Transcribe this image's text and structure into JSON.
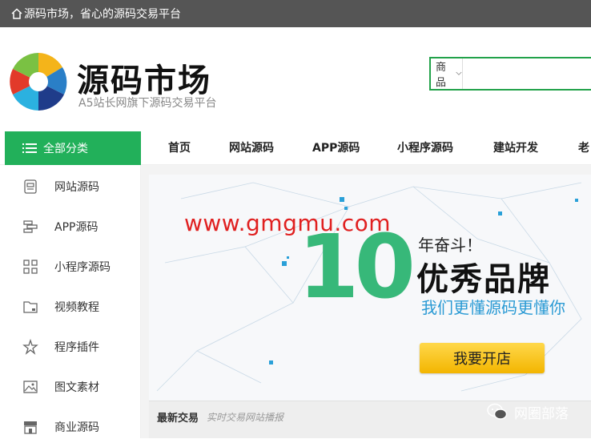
{
  "topbar": {
    "text": "源码市场，省心的源码交易平台"
  },
  "header": {
    "logo_title": "源码市场",
    "logo_subtitle": "A5站长网旗下源码交易平台"
  },
  "search": {
    "select_value": "商品",
    "input_value": "",
    "placeholder": ""
  },
  "nav": {
    "all_categories": "全部分类",
    "items": [
      "首页",
      "网站源码",
      "APP源码",
      "小程序源码",
      "建站开发",
      "老"
    ]
  },
  "sidebar": {
    "items": [
      {
        "label": "网站源码",
        "icon": "website-icon"
      },
      {
        "label": "APP源码",
        "icon": "app-icon"
      },
      {
        "label": "小程序源码",
        "icon": "grid-icon"
      },
      {
        "label": "视频教程",
        "icon": "folder-icon"
      },
      {
        "label": "程序插件",
        "icon": "plugin-icon"
      },
      {
        "label": "图文素材",
        "icon": "image-icon"
      },
      {
        "label": "商业源码",
        "icon": "store-icon"
      }
    ]
  },
  "banner": {
    "watermark_url": "www.gmgmu.com",
    "big_number": "10",
    "line1": "年奋斗！",
    "line2": "优秀品牌",
    "line3": "我们更懂源码更懂你",
    "cta": "我要开店",
    "colors": {
      "accent": "#22b05a",
      "cta": "#f5bf1a",
      "url": "#e02020"
    }
  },
  "trade": {
    "title": "最新交易",
    "subtitle": "实时交易网站播报"
  },
  "watermark_badge": {
    "text": "网圈部落"
  }
}
